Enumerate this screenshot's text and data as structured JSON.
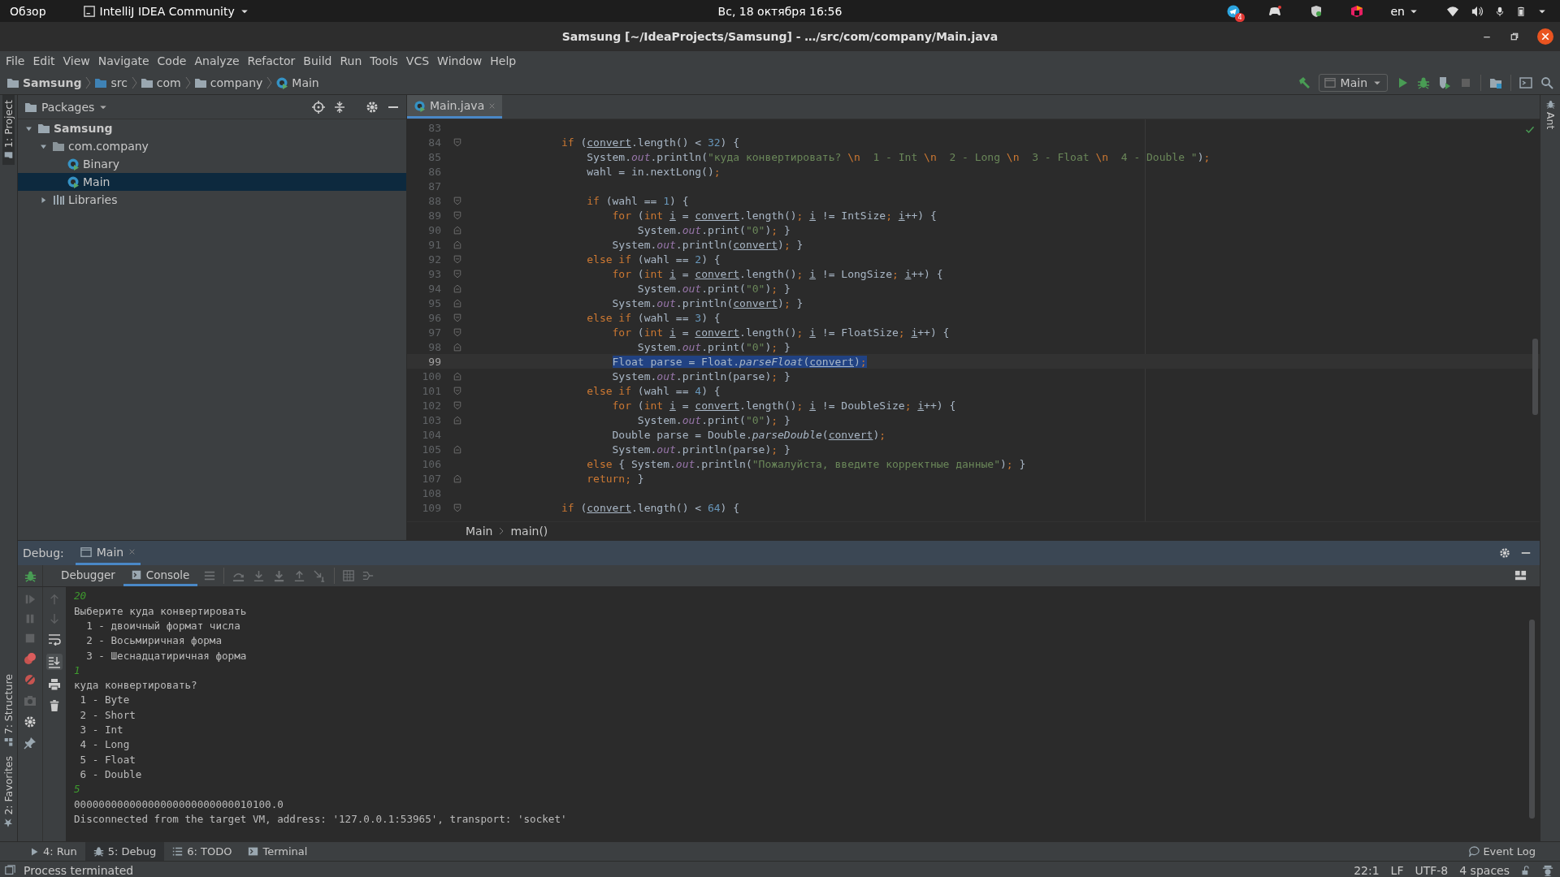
{
  "system_bar": {
    "activities": "Обзор",
    "app_menu": "IntelliJ IDEA Community",
    "clock": "Вс, 18 октября 16:56",
    "notification_count": "4",
    "keyboard_layout": "en"
  },
  "window": {
    "title": "Samsung [~/IdeaProjects/Samsung] - …/src/com/company/Main.java"
  },
  "menu": [
    "File",
    "Edit",
    "View",
    "Navigate",
    "Code",
    "Analyze",
    "Refactor",
    "Build",
    "Run",
    "Tools",
    "VCS",
    "Window",
    "Help"
  ],
  "breadcrumbs": [
    {
      "label": "Samsung",
      "kind": "project"
    },
    {
      "label": "src",
      "kind": "source"
    },
    {
      "label": "com",
      "kind": "package"
    },
    {
      "label": "company",
      "kind": "package"
    },
    {
      "label": "Main",
      "kind": "class"
    }
  ],
  "toolbar": {
    "run_config": "Main"
  },
  "tool_stripes": {
    "left_top": "1: Project",
    "left_bottom": [
      "7: Structure",
      "2: Favorites"
    ],
    "right": "Ant"
  },
  "project_panel": {
    "view": "Packages",
    "tree": [
      {
        "label": "Samsung",
        "kind": "project",
        "expanded": true,
        "selected": false,
        "children": [
          {
            "label": "com.company",
            "kind": "package",
            "expanded": true,
            "selected": false,
            "children": [
              {
                "label": "Binary",
                "kind": "class",
                "selected": false
              },
              {
                "label": "Main",
                "kind": "class",
                "selected": true
              }
            ]
          },
          {
            "label": "Libraries",
            "kind": "libraries",
            "expanded": false,
            "selected": false
          }
        ]
      }
    ]
  },
  "editor": {
    "tabs": [
      {
        "label": "Main.java",
        "selected": true
      }
    ],
    "lines": [
      {
        "number": "83",
        "current": false,
        "kind": "plain"
      },
      {
        "number": "84",
        "current": false,
        "kind": "opener",
        "tokens": [
          {
            "text": "            if",
            "kind": "keyword"
          },
          {
            "text": " (",
            "kind": "plain"
          },
          {
            "text": "convert",
            "kind": "variable"
          },
          {
            "text": ".length() < ",
            "kind": "plain"
          },
          {
            "text": "32",
            "kind": "number"
          },
          {
            "text": ") {",
            "kind": "plain"
          }
        ]
      },
      {
        "number": "85",
        "current": false,
        "kind": "plain",
        "tokens": [
          {
            "text": "                System.",
            "kind": "plain"
          },
          {
            "text": "out",
            "kind": "field"
          },
          {
            "text": ".println(",
            "kind": "plain"
          },
          {
            "text": "\"куда конвертировать? ",
            "kind": "string"
          },
          {
            "text": "\\n",
            "kind": "escape"
          },
          {
            "text": "  1 - Int ",
            "kind": "string"
          },
          {
            "text": "\\n",
            "kind": "escape"
          },
          {
            "text": "  2 - Long ",
            "kind": "string"
          },
          {
            "text": "\\n",
            "kind": "escape"
          },
          {
            "text": "  3 - Float ",
            "kind": "string"
          },
          {
            "text": "\\n",
            "kind": "escape"
          },
          {
            "text": "  4 - Double \"",
            "kind": "string"
          },
          {
            "text": ")",
            "kind": "plain"
          },
          {
            "text": ";",
            "kind": "keyword"
          }
        ]
      },
      {
        "number": "86",
        "current": false,
        "kind": "plain",
        "tokens": [
          {
            "text": "                wahl = in.nextLong()",
            "kind": "plain"
          },
          {
            "text": ";",
            "kind": "keyword"
          }
        ]
      },
      {
        "number": "87",
        "current": false,
        "kind": "plain"
      },
      {
        "number": "88",
        "current": false,
        "kind": "opener",
        "tokens": [
          {
            "text": "                if",
            "kind": "keyword"
          },
          {
            "text": " (wahl == ",
            "kind": "plain"
          },
          {
            "text": "1",
            "kind": "number"
          },
          {
            "text": ") {",
            "kind": "plain"
          }
        ]
      },
      {
        "number": "89",
        "current": false,
        "kind": "opener",
        "tokens": [
          {
            "text": "                    for",
            "kind": "keyword"
          },
          {
            "text": " (",
            "kind": "plain"
          },
          {
            "text": "int ",
            "kind": "keyword"
          },
          {
            "text": "i",
            "kind": "variable"
          },
          {
            "text": " = ",
            "kind": "plain"
          },
          {
            "text": "convert",
            "kind": "variable"
          },
          {
            "text": ".length()",
            "kind": "plain"
          },
          {
            "text": "; ",
            "kind": "keyword"
          },
          {
            "text": "i",
            "kind": "variable"
          },
          {
            "text": " != IntSize",
            "kind": "plain"
          },
          {
            "text": "; ",
            "kind": "keyword"
          },
          {
            "text": "i",
            "kind": "variable"
          },
          {
            "text": "++) {",
            "kind": "plain"
          }
        ]
      },
      {
        "number": "90",
        "current": false,
        "kind": "closer",
        "tokens": [
          {
            "text": "                        System.",
            "kind": "plain"
          },
          {
            "text": "out",
            "kind": "field"
          },
          {
            "text": ".print(",
            "kind": "plain"
          },
          {
            "text": "\"0\"",
            "kind": "string"
          },
          {
            "text": ")",
            "kind": "plain"
          },
          {
            "text": ";",
            "kind": "keyword"
          },
          {
            "text": " }",
            "kind": "plain"
          }
        ]
      },
      {
        "number": "91",
        "current": false,
        "kind": "closer",
        "tokens": [
          {
            "text": "                    System.",
            "kind": "plain"
          },
          {
            "text": "out",
            "kind": "field"
          },
          {
            "text": ".println(",
            "kind": "plain"
          },
          {
            "text": "convert",
            "kind": "variable"
          },
          {
            "text": ")",
            "kind": "plain"
          },
          {
            "text": ";",
            "kind": "keyword"
          },
          {
            "text": " }",
            "kind": "plain"
          }
        ]
      },
      {
        "number": "92",
        "current": false,
        "kind": "opener",
        "tokens": [
          {
            "text": "                else if",
            "kind": "keyword"
          },
          {
            "text": " (wahl == ",
            "kind": "plain"
          },
          {
            "text": "2",
            "kind": "number"
          },
          {
            "text": ") {",
            "kind": "plain"
          }
        ]
      },
      {
        "number": "93",
        "current": false,
        "kind": "opener",
        "tokens": [
          {
            "text": "                    for",
            "kind": "keyword"
          },
          {
            "text": " (",
            "kind": "plain"
          },
          {
            "text": "int ",
            "kind": "keyword"
          },
          {
            "text": "i",
            "kind": "variable"
          },
          {
            "text": " = ",
            "kind": "plain"
          },
          {
            "text": "convert",
            "kind": "variable"
          },
          {
            "text": ".length()",
            "kind": "plain"
          },
          {
            "text": "; ",
            "kind": "keyword"
          },
          {
            "text": "i",
            "kind": "variable"
          },
          {
            "text": " != LongSize",
            "kind": "plain"
          },
          {
            "text": "; ",
            "kind": "keyword"
          },
          {
            "text": "i",
            "kind": "variable"
          },
          {
            "text": "++) {",
            "kind": "plain"
          }
        ]
      },
      {
        "number": "94",
        "current": false,
        "kind": "closer",
        "tokens": [
          {
            "text": "                        System.",
            "kind": "plain"
          },
          {
            "text": "out",
            "kind": "field"
          },
          {
            "text": ".print(",
            "kind": "plain"
          },
          {
            "text": "\"0\"",
            "kind": "string"
          },
          {
            "text": ")",
            "kind": "plain"
          },
          {
            "text": ";",
            "kind": "keyword"
          },
          {
            "text": " }",
            "kind": "plain"
          }
        ]
      },
      {
        "number": "95",
        "current": false,
        "kind": "closer",
        "tokens": [
          {
            "text": "                    System.",
            "kind": "plain"
          },
          {
            "text": "out",
            "kind": "field"
          },
          {
            "text": ".println(",
            "kind": "plain"
          },
          {
            "text": "convert",
            "kind": "variable"
          },
          {
            "text": ")",
            "kind": "plain"
          },
          {
            "text": ";",
            "kind": "keyword"
          },
          {
            "text": " }",
            "kind": "plain"
          }
        ]
      },
      {
        "number": "96",
        "current": false,
        "kind": "opener",
        "tokens": [
          {
            "text": "                else if",
            "kind": "keyword"
          },
          {
            "text": " (wahl == ",
            "kind": "plain"
          },
          {
            "text": "3",
            "kind": "number"
          },
          {
            "text": ") {",
            "kind": "plain"
          }
        ]
      },
      {
        "number": "97",
        "current": false,
        "kind": "opener",
        "tokens": [
          {
            "text": "                    for",
            "kind": "keyword"
          },
          {
            "text": " (",
            "kind": "plain"
          },
          {
            "text": "int ",
            "kind": "keyword"
          },
          {
            "text": "i",
            "kind": "variable"
          },
          {
            "text": " = ",
            "kind": "plain"
          },
          {
            "text": "convert",
            "kind": "variable"
          },
          {
            "text": ".length()",
            "kind": "plain"
          },
          {
            "text": "; ",
            "kind": "keyword"
          },
          {
            "text": "i",
            "kind": "variable"
          },
          {
            "text": " != FloatSize",
            "kind": "plain"
          },
          {
            "text": "; ",
            "kind": "keyword"
          },
          {
            "text": "i",
            "kind": "variable"
          },
          {
            "text": "++) {",
            "kind": "plain"
          }
        ]
      },
      {
        "number": "98",
        "current": false,
        "kind": "closer",
        "tokens": [
          {
            "text": "                        System.",
            "kind": "plain"
          },
          {
            "text": "out",
            "kind": "field"
          },
          {
            "text": ".print(",
            "kind": "plain"
          },
          {
            "text": "\"0\"",
            "kind": "string"
          },
          {
            "text": ")",
            "kind": "plain"
          },
          {
            "text": ";",
            "kind": "keyword"
          },
          {
            "text": " }",
            "kind": "plain"
          }
        ]
      },
      {
        "number": "99",
        "current": true,
        "kind": "plain",
        "tokens": [
          {
            "text": "                    Float parse = Float.",
            "kind": "plain"
          },
          {
            "text": "parseFloat",
            "kind": "method"
          },
          {
            "text": "(",
            "kind": "plain"
          },
          {
            "text": "convert",
            "kind": "variable"
          },
          {
            "text": ")",
            "kind": "plain"
          },
          {
            "text": ";",
            "kind": "keyword"
          }
        ]
      },
      {
        "number": "100",
        "current": false,
        "kind": "closer",
        "tokens": [
          {
            "text": "                    System.",
            "kind": "plain"
          },
          {
            "text": "out",
            "kind": "field"
          },
          {
            "text": ".println(parse)",
            "kind": "plain"
          },
          {
            "text": ";",
            "kind": "keyword"
          },
          {
            "text": " }",
            "kind": "plain"
          }
        ]
      },
      {
        "number": "101",
        "current": false,
        "kind": "opener",
        "tokens": [
          {
            "text": "                else if",
            "kind": "keyword"
          },
          {
            "text": " (wahl == ",
            "kind": "plain"
          },
          {
            "text": "4",
            "kind": "number"
          },
          {
            "text": ") {",
            "kind": "plain"
          }
        ]
      },
      {
        "number": "102",
        "current": false,
        "kind": "opener",
        "tokens": [
          {
            "text": "                    for",
            "kind": "keyword"
          },
          {
            "text": " (",
            "kind": "plain"
          },
          {
            "text": "int ",
            "kind": "keyword"
          },
          {
            "text": "i",
            "kind": "variable"
          },
          {
            "text": " = ",
            "kind": "plain"
          },
          {
            "text": "convert",
            "kind": "variable"
          },
          {
            "text": ".length()",
            "kind": "plain"
          },
          {
            "text": "; ",
            "kind": "keyword"
          },
          {
            "text": "i",
            "kind": "variable"
          },
          {
            "text": " != DoubleSize",
            "kind": "plain"
          },
          {
            "text": "; ",
            "kind": "keyword"
          },
          {
            "text": "i",
            "kind": "variable"
          },
          {
            "text": "++) {",
            "kind": "plain"
          }
        ]
      },
      {
        "number": "103",
        "current": false,
        "kind": "closer",
        "tokens": [
          {
            "text": "                        System.",
            "kind": "plain"
          },
          {
            "text": "out",
            "kind": "field"
          },
          {
            "text": ".print(",
            "kind": "plain"
          },
          {
            "text": "\"0\"",
            "kind": "string"
          },
          {
            "text": ")",
            "kind": "plain"
          },
          {
            "text": ";",
            "kind": "keyword"
          },
          {
            "text": " }",
            "kind": "plain"
          }
        ]
      },
      {
        "number": "104",
        "current": false,
        "kind": "plain",
        "tokens": [
          {
            "text": "                    Double parse = Double.",
            "kind": "plain"
          },
          {
            "text": "parseDouble",
            "kind": "method"
          },
          {
            "text": "(",
            "kind": "plain"
          },
          {
            "text": "convert",
            "kind": "variable"
          },
          {
            "text": ")",
            "kind": "plain"
          },
          {
            "text": ";",
            "kind": "keyword"
          }
        ]
      },
      {
        "number": "105",
        "current": false,
        "kind": "closer",
        "tokens": [
          {
            "text": "                    System.",
            "kind": "plain"
          },
          {
            "text": "out",
            "kind": "field"
          },
          {
            "text": ".println(parse)",
            "kind": "plain"
          },
          {
            "text": ";",
            "kind": "keyword"
          },
          {
            "text": " }",
            "kind": "plain"
          }
        ]
      },
      {
        "number": "106",
        "current": false,
        "kind": "plain",
        "tokens": [
          {
            "text": "                else",
            "kind": "keyword"
          },
          {
            "text": " { System.",
            "kind": "plain"
          },
          {
            "text": "out",
            "kind": "field"
          },
          {
            "text": ".println(",
            "kind": "plain"
          },
          {
            "text": "\"Пожалуйста, введите корректные данные\"",
            "kind": "string"
          },
          {
            "text": ")",
            "kind": "plain"
          },
          {
            "text": ";",
            "kind": "keyword"
          },
          {
            "text": " }",
            "kind": "plain"
          }
        ]
      },
      {
        "number": "107",
        "current": false,
        "kind": "closer",
        "tokens": [
          {
            "text": "                return",
            "kind": "keyword"
          },
          {
            "text": ";",
            "kind": "keyword"
          },
          {
            "text": " }",
            "kind": "plain"
          }
        ]
      },
      {
        "number": "108",
        "current": false,
        "kind": "plain"
      },
      {
        "number": "109",
        "current": false,
        "kind": "opener",
        "tokens": [
          {
            "text": "            if",
            "kind": "keyword"
          },
          {
            "text": " (",
            "kind": "plain"
          },
          {
            "text": "convert",
            "kind": "variable"
          },
          {
            "text": ".length() < ",
            "kind": "plain"
          },
          {
            "text": "64",
            "kind": "number"
          },
          {
            "text": ") {",
            "kind": "plain"
          }
        ]
      }
    ],
    "breadcrumbs": [
      "Main",
      "main()"
    ]
  },
  "debug": {
    "title": "Debug:",
    "tabs": [
      {
        "label": "Main",
        "selected": true
      }
    ],
    "subtabs": [
      {
        "label": "Debugger",
        "selected": false
      },
      {
        "label": "Console",
        "selected": true
      }
    ],
    "console": [
      {
        "text": "20",
        "kind": "input"
      },
      {
        "text": "Выберите куда конвертировать",
        "kind": "output"
      },
      {
        "text": "  1 - двоичный формат числа",
        "kind": "output"
      },
      {
        "text": "  2 - Восьмиричная форма",
        "kind": "output"
      },
      {
        "text": "  3 - Шеснадцатиричная форма",
        "kind": "output"
      },
      {
        "text": "1",
        "kind": "input"
      },
      {
        "text": "куда конвертировать?",
        "kind": "output"
      },
      {
        "text": " 1 - Byte",
        "kind": "output"
      },
      {
        "text": " 2 - Short",
        "kind": "output"
      },
      {
        "text": " 3 - Int",
        "kind": "output"
      },
      {
        "text": " 4 - Long",
        "kind": "output"
      },
      {
        "text": " 5 - Float",
        "kind": "output"
      },
      {
        "text": " 6 - Double",
        "kind": "output"
      },
      {
        "text": "5",
        "kind": "input"
      },
      {
        "text": "00000000000000000000000000010100.0",
        "kind": "output"
      },
      {
        "text": "Disconnected from the target VM, address: '127.0.0.1:53965', transport: 'socket'",
        "kind": "output"
      }
    ]
  },
  "bottom_tabs": [
    {
      "label": "4: Run",
      "kind": "run",
      "selected": false
    },
    {
      "label": "5: Debug",
      "kind": "debug",
      "selected": true
    },
    {
      "label": "6: TODO",
      "kind": "todo",
      "selected": false
    },
    {
      "label": "Terminal",
      "kind": "terminal",
      "selected": false
    }
  ],
  "event_log": "Event Log",
  "status_bar": {
    "message": "Process terminated",
    "position": "22:1",
    "line_separator": "LF",
    "encoding": "UTF-8",
    "indent": "4 spaces"
  }
}
